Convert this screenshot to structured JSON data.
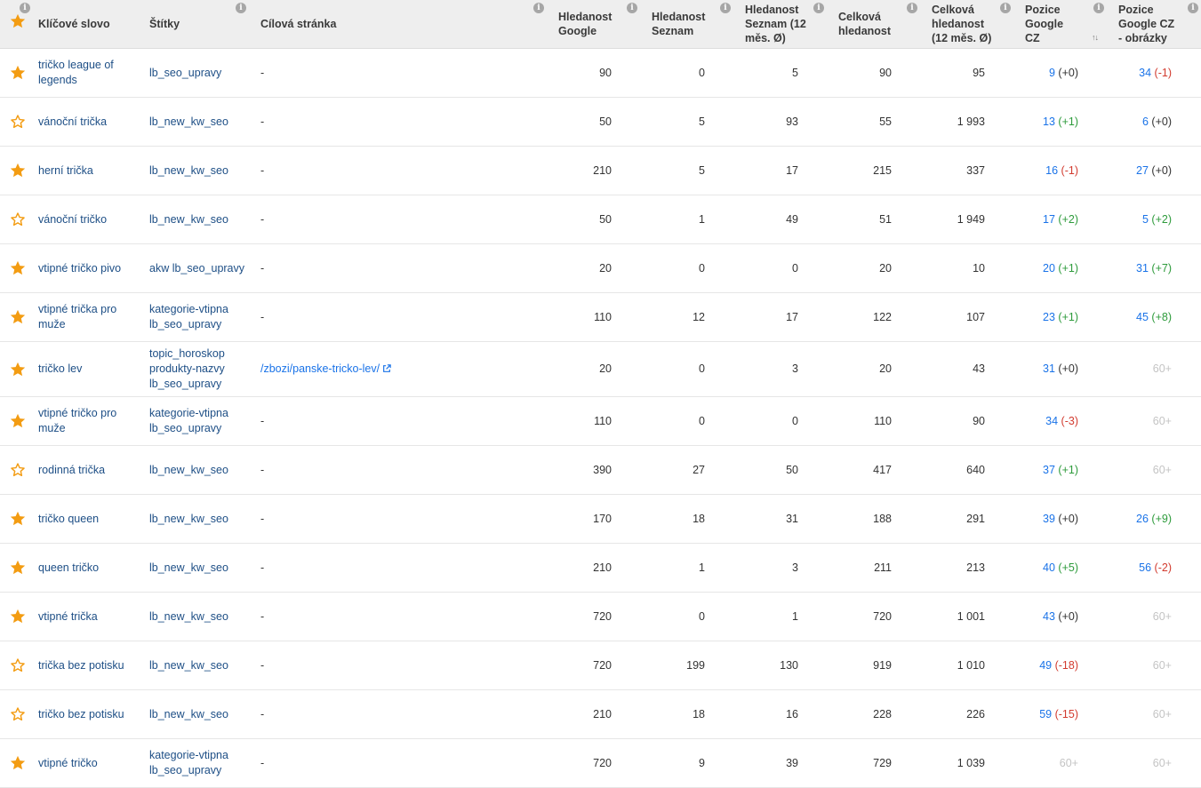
{
  "header": {
    "star_icon": "star-filled-icon",
    "columns": {
      "keyword": "Klíčové slovo",
      "tags": "Štítky",
      "target": "Cílová stránka",
      "google": "Hledanost Google",
      "seznam": "Hledanost Seznam",
      "seznam12": "Hledanost Seznam (12 měs. Ø)",
      "total": "Celková hledanost",
      "total12": "Celková hledanost (12 měs. Ø)",
      "pos": "Pozice Google CZ",
      "posimg": "Pozice Google CZ - obrázky"
    },
    "info_glyph": "i",
    "sort_glyph": "↑↓"
  },
  "colors": {
    "star": "#f39c12",
    "link": "#1a73e8",
    "keyword": "#1e4f86",
    "change_up": "#2e9b3c",
    "change_down": "#d23b2f",
    "not_ranked": "#c4c4c4",
    "header_bg": "#eeeeee"
  },
  "rows": [
    {
      "starred": true,
      "keyword": "tričko league of legends",
      "tags": [
        "lb_seo_upravy"
      ],
      "target": "-",
      "google": "90",
      "seznam": "0",
      "seznam12": "5",
      "total": "90",
      "total12": "95",
      "pos": "9",
      "pos_change": "(+0)",
      "img": "34",
      "img_change": "(-1)"
    },
    {
      "starred": false,
      "keyword": "vánoční trička",
      "tags": [
        "lb_new_kw_seo"
      ],
      "target": "-",
      "google": "50",
      "seznam": "5",
      "seznam12": "93",
      "total": "55",
      "total12": "1 993",
      "pos": "13",
      "pos_change": "(+1)",
      "img": "6",
      "img_change": "(+0)"
    },
    {
      "starred": true,
      "keyword": "herní trička",
      "tags": [
        "lb_new_kw_seo"
      ],
      "target": "-",
      "google": "210",
      "seznam": "5",
      "seznam12": "17",
      "total": "215",
      "total12": "337",
      "pos": "16",
      "pos_change": "(-1)",
      "img": "27",
      "img_change": "(+0)"
    },
    {
      "starred": false,
      "keyword": "vánoční tričko",
      "tags": [
        "lb_new_kw_seo"
      ],
      "target": "-",
      "google": "50",
      "seznam": "1",
      "seznam12": "49",
      "total": "51",
      "total12": "1 949",
      "pos": "17",
      "pos_change": "(+2)",
      "img": "5",
      "img_change": "(+2)"
    },
    {
      "starred": true,
      "keyword": "vtipné tričko pivo",
      "tags": [
        "akw lb_seo_upravy"
      ],
      "target": "-",
      "google": "20",
      "seznam": "0",
      "seznam12": "0",
      "total": "20",
      "total12": "10",
      "pos": "20",
      "pos_change": "(+1)",
      "img": "31",
      "img_change": "(+7)"
    },
    {
      "starred": true,
      "keyword": "vtipné trička pro muže",
      "tags": [
        "kategorie-vtipna",
        "lb_seo_upravy"
      ],
      "target": "-",
      "google": "110",
      "seznam": "12",
      "seznam12": "17",
      "total": "122",
      "total12": "107",
      "pos": "23",
      "pos_change": "(+1)",
      "img": "45",
      "img_change": "(+8)"
    },
    {
      "starred": true,
      "keyword": "tričko lev",
      "tags": [
        "topic_horoskop",
        "produkty-nazvy",
        "lb_seo_upravy"
      ],
      "target": "/zbozi/panske-tricko-lev/",
      "google": "20",
      "seznam": "0",
      "seznam12": "3",
      "total": "20",
      "total12": "43",
      "pos": "31",
      "pos_change": "(+0)",
      "img": "60+",
      "img_change": ""
    },
    {
      "starred": true,
      "keyword": "vtipné tričko pro muže",
      "tags": [
        "kategorie-vtipna",
        "lb_seo_upravy"
      ],
      "target": "-",
      "google": "110",
      "seznam": "0",
      "seznam12": "0",
      "total": "110",
      "total12": "90",
      "pos": "34",
      "pos_change": "(-3)",
      "img": "60+",
      "img_change": ""
    },
    {
      "starred": false,
      "keyword": "rodinná trička",
      "tags": [
        "lb_new_kw_seo"
      ],
      "target": "-",
      "google": "390",
      "seznam": "27",
      "seznam12": "50",
      "total": "417",
      "total12": "640",
      "pos": "37",
      "pos_change": "(+1)",
      "img": "60+",
      "img_change": ""
    },
    {
      "starred": true,
      "keyword": "tričko queen",
      "tags": [
        "lb_new_kw_seo"
      ],
      "target": "-",
      "google": "170",
      "seznam": "18",
      "seznam12": "31",
      "total": "188",
      "total12": "291",
      "pos": "39",
      "pos_change": "(+0)",
      "img": "26",
      "img_change": "(+9)"
    },
    {
      "starred": true,
      "keyword": "queen tričko",
      "tags": [
        "lb_new_kw_seo"
      ],
      "target": "-",
      "google": "210",
      "seznam": "1",
      "seznam12": "3",
      "total": "211",
      "total12": "213",
      "pos": "40",
      "pos_change": "(+5)",
      "img": "56",
      "img_change": "(-2)"
    },
    {
      "starred": true,
      "keyword": "vtipné trička",
      "tags": [
        "lb_new_kw_seo"
      ],
      "target": "-",
      "google": "720",
      "seznam": "0",
      "seznam12": "1",
      "total": "720",
      "total12": "1 001",
      "pos": "43",
      "pos_change": "(+0)",
      "img": "60+",
      "img_change": ""
    },
    {
      "starred": false,
      "keyword": "trička bez potisku",
      "tags": [
        "lb_new_kw_seo"
      ],
      "target": "-",
      "google": "720",
      "seznam": "199",
      "seznam12": "130",
      "total": "919",
      "total12": "1 010",
      "pos": "49",
      "pos_change": "(-18)",
      "img": "60+",
      "img_change": ""
    },
    {
      "starred": false,
      "keyword": "tričko bez potisku",
      "tags": [
        "lb_new_kw_seo"
      ],
      "target": "-",
      "google": "210",
      "seznam": "18",
      "seznam12": "16",
      "total": "228",
      "total12": "226",
      "pos": "59",
      "pos_change": "(-15)",
      "img": "60+",
      "img_change": ""
    },
    {
      "starred": true,
      "keyword": "vtipné tričko",
      "tags": [
        "kategorie-vtipna",
        "lb_seo_upravy"
      ],
      "target": "-",
      "google": "720",
      "seznam": "9",
      "seznam12": "39",
      "total": "729",
      "total12": "1 039",
      "pos": "60+",
      "pos_change": "",
      "img": "60+",
      "img_change": ""
    }
  ]
}
